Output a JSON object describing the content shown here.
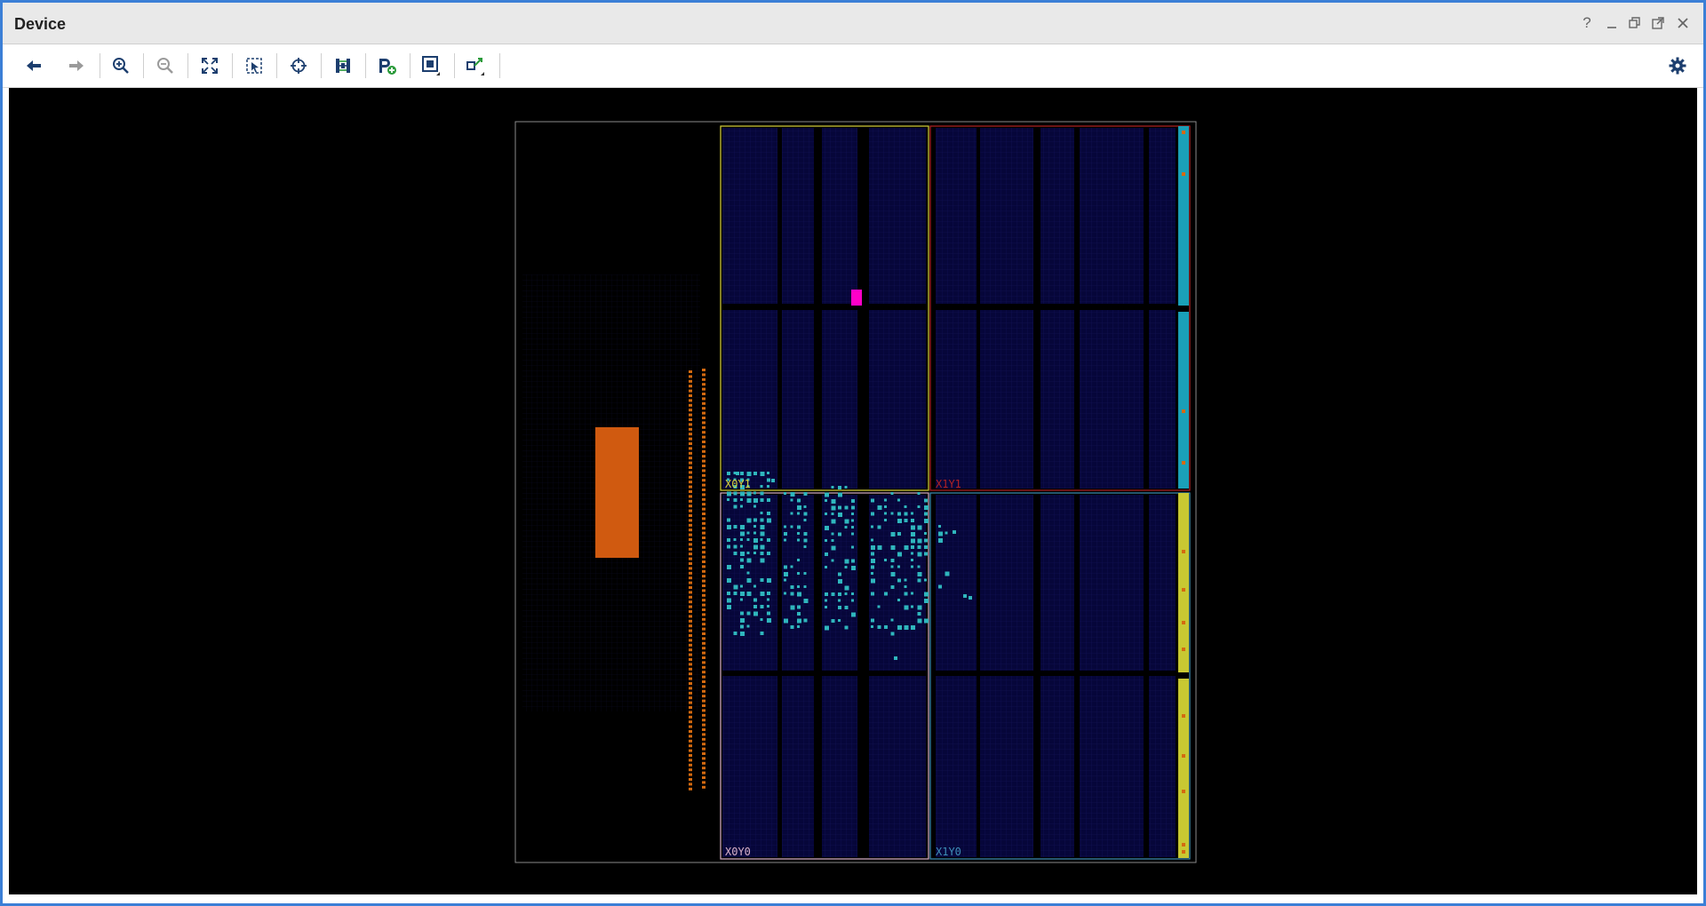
{
  "window": {
    "title": "Device",
    "controls": [
      "help-icon",
      "minimize-icon",
      "restore-icon",
      "maximize-icon",
      "close-icon"
    ],
    "help_glyph": "?"
  },
  "toolbar": {
    "buttons": [
      {
        "name": "back-button",
        "icon": "arrow-left-icon",
        "enabled": true
      },
      {
        "name": "forward-button",
        "icon": "arrow-right-icon",
        "enabled": false
      },
      {
        "name": "zoom-in-button",
        "icon": "zoom-in-icon",
        "enabled": true
      },
      {
        "name": "zoom-out-button",
        "icon": "zoom-out-icon",
        "enabled": false
      },
      {
        "name": "zoom-fit-button",
        "icon": "fit-icon",
        "enabled": true
      },
      {
        "name": "zoom-area-button",
        "icon": "zoom-area-icon",
        "enabled": true
      },
      {
        "name": "autofit-selection-button",
        "icon": "crosshair-icon",
        "enabled": true
      },
      {
        "name": "routing-resources-button",
        "icon": "routing-icon",
        "enabled": true
      },
      {
        "name": "create-pblock-button",
        "icon": "pblock-add-icon",
        "enabled": true
      },
      {
        "name": "reports-button",
        "icon": "frame-icon",
        "enabled": true
      },
      {
        "name": "show-connections-button",
        "icon": "connections-icon",
        "enabled": true
      }
    ],
    "settings_icon": "gear-icon"
  },
  "device_view": {
    "clock_regions": [
      {
        "label": "X0Y1",
        "color": "#d8d23a"
      },
      {
        "label": "X1Y1",
        "color": "#b22222"
      },
      {
        "label": "X0Y0",
        "color": "#d8b0c8"
      },
      {
        "label": "X1Y0",
        "color": "#3e8fb8"
      }
    ],
    "colors": {
      "background": "#000000",
      "fabric": "#07073a",
      "cells": "#2fb6bd",
      "io_bank_teal": "#1aa0b8",
      "io_bank_yellow": "#c8c832",
      "io_pins": "#d46a10",
      "highlight": "#ff00c8",
      "ps_block": "#d05a10"
    }
  }
}
